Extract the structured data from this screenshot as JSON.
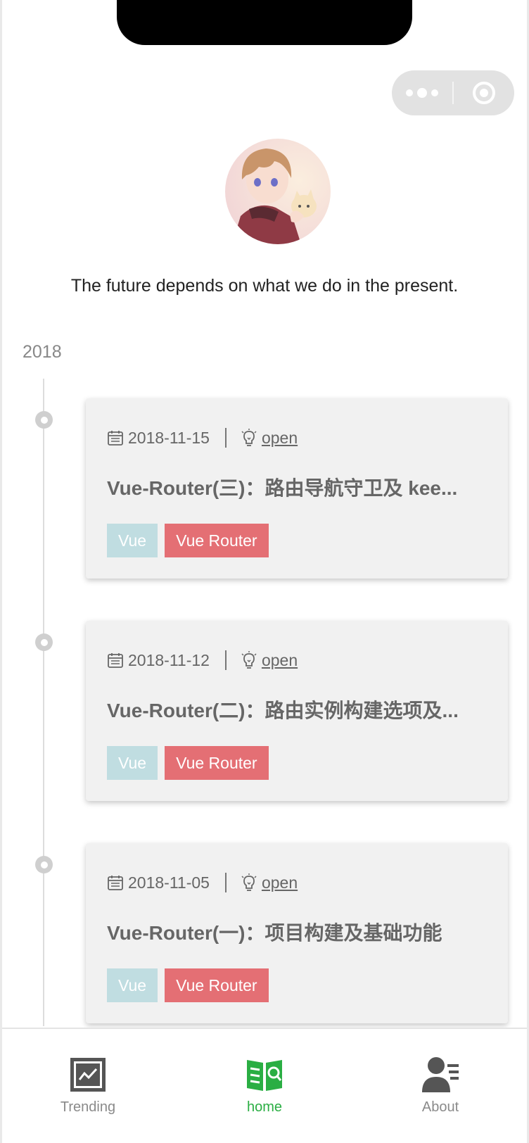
{
  "profile": {
    "motto": "The future depends on what we do in the present."
  },
  "timeline": {
    "year": "2018",
    "posts": [
      {
        "date": "2018-11-15",
        "status": "open",
        "title": "Vue-Router(三)：路由导航守卫及 kee...",
        "tags": [
          "Vue",
          "Vue Router"
        ]
      },
      {
        "date": "2018-11-12",
        "status": "open",
        "title": "Vue-Router(二)：路由实例构建选项及...",
        "tags": [
          "Vue",
          "Vue Router"
        ]
      },
      {
        "date": "2018-11-05",
        "status": "open",
        "title": "Vue-Router(一)：项目构建及基础功能",
        "tags": [
          "Vue",
          "Vue Router"
        ]
      }
    ]
  },
  "tabbar": {
    "tabs": [
      {
        "label": "Trending",
        "icon": "trending-icon",
        "active": false
      },
      {
        "label": "home",
        "icon": "home-book-icon",
        "active": true
      },
      {
        "label": "About",
        "icon": "about-user-icon",
        "active": false
      }
    ]
  },
  "colors": {
    "tag_vue": "#c0dde1",
    "tag_router": "#e46f74",
    "tab_active": "#2aae43",
    "card_bg": "#f1f1f1"
  },
  "icons": {
    "capsule_more": "more-dots-icon",
    "capsule_close": "target-close-icon",
    "date": "calendar-icon",
    "status": "lightbulb-icon"
  }
}
